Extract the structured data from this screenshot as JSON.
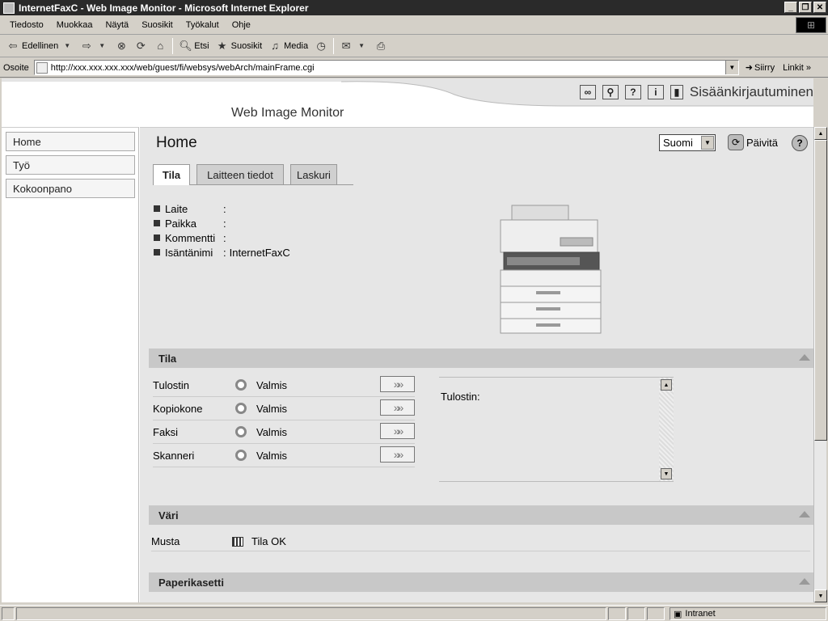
{
  "window": {
    "title": "InternetFaxC - Web Image Monitor - Microsoft Internet Explorer"
  },
  "menu": [
    "Tiedosto",
    "Muokkaa",
    "Näytä",
    "Suosikit",
    "Työkalut",
    "Ohje"
  ],
  "toolbar": {
    "back": "Edellinen",
    "search": "Etsi",
    "favorites": "Suosikit",
    "media": "Media"
  },
  "address": {
    "label": "Osoite",
    "url": "http://xxx.xxx.xxx.xxx/web/guest/fi/websys/webArch/mainFrame.cgi",
    "go": "Siirry",
    "links": "Linkit"
  },
  "header": {
    "brand": "Web Image Monitor",
    "login": "Sisäänkirjautuminen"
  },
  "sidebar": {
    "items": [
      "Home",
      "Työ",
      "Kokoonpano"
    ]
  },
  "page": {
    "title": "Home",
    "language": "Suomi",
    "refresh": "Päivitä",
    "tabs": [
      "Tila",
      "Laitteen tiedot",
      "Laskuri"
    ],
    "info": [
      {
        "label": "Laite",
        "sep": ":",
        "value": ""
      },
      {
        "label": "Paikka",
        "sep": ":",
        "value": ""
      },
      {
        "label": "Kommentti",
        "sep": ":",
        "value": ""
      },
      {
        "label": "Isäntänimi",
        "sep": ":",
        "value": "InternetFaxC"
      }
    ]
  },
  "status_section": {
    "title": "Tila",
    "rows": [
      {
        "label": "Tulostin",
        "status": "Valmis"
      },
      {
        "label": "Kopiokone",
        "status": "Valmis"
      },
      {
        "label": "Faksi",
        "status": "Valmis"
      },
      {
        "label": "Skanneri",
        "status": "Valmis"
      }
    ],
    "message_label": "Tulostin:"
  },
  "color_section": {
    "title": "Väri",
    "row": {
      "label": "Musta",
      "status": "Tila OK"
    }
  },
  "paper_section": {
    "title": "Paperikasetti"
  },
  "statusbar": {
    "zone": "Intranet"
  }
}
